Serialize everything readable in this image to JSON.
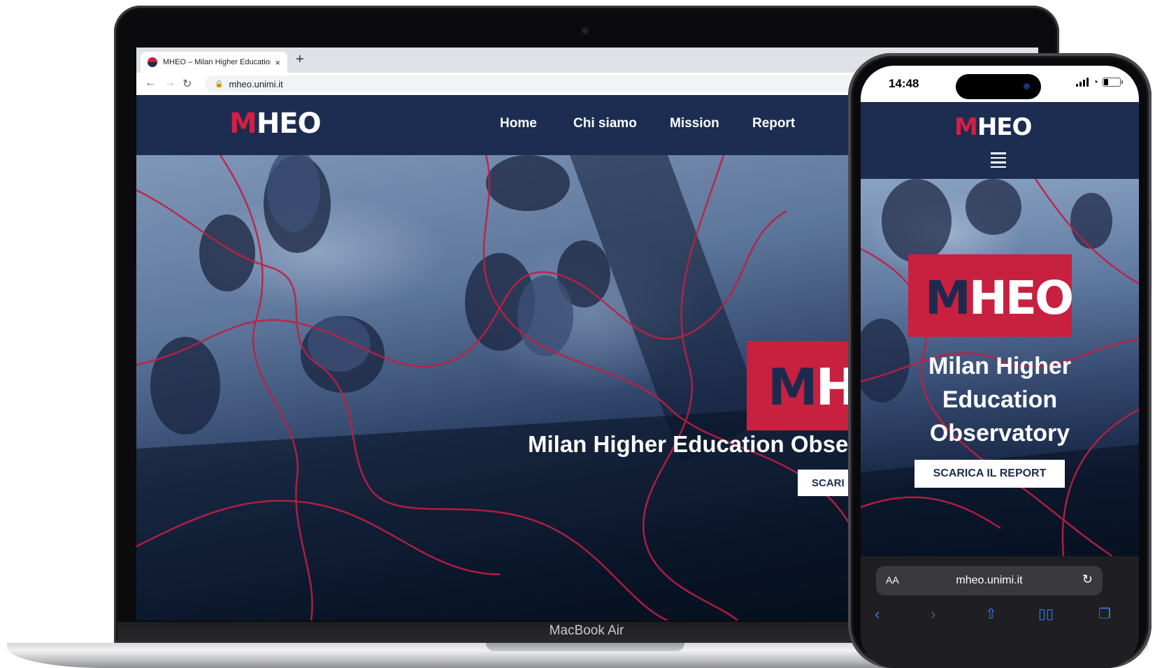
{
  "laptop": {
    "model_label": "MacBook Air",
    "browser": {
      "tab_title": "MHEO – Milan Higher Education",
      "tab_close": "×",
      "new_tab": "+",
      "back_icon": "←",
      "forward_icon": "→",
      "reload_icon": "↻",
      "url": "mheo.unimi.it"
    },
    "site": {
      "logo_m": "M",
      "logo_rest": "HEO",
      "nav": [
        "Home",
        "Chi siamo",
        "Mission",
        "Report"
      ],
      "badge_m": "M",
      "badge_h": "H",
      "hero_title": "Milan Higher Education Obse",
      "hero_button": "SCARI"
    }
  },
  "phone": {
    "time": "14:48",
    "logo_m": "M",
    "logo_rest": "HEO",
    "badge_m": "M",
    "badge_rest": "HEO",
    "hero_title_lines": [
      "Milan Higher",
      "Education",
      "Observatory"
    ],
    "hero_button": "SCARICA IL REPORT",
    "safari": {
      "aa": "AA",
      "url": "mheo.unimi.it",
      "reload_icon": "↻"
    }
  },
  "colors": {
    "brand_navy": "#1c2d51",
    "brand_red": "#c8203f",
    "accent_red": "#d31f44",
    "safari_blue": "#2f7cf6"
  }
}
